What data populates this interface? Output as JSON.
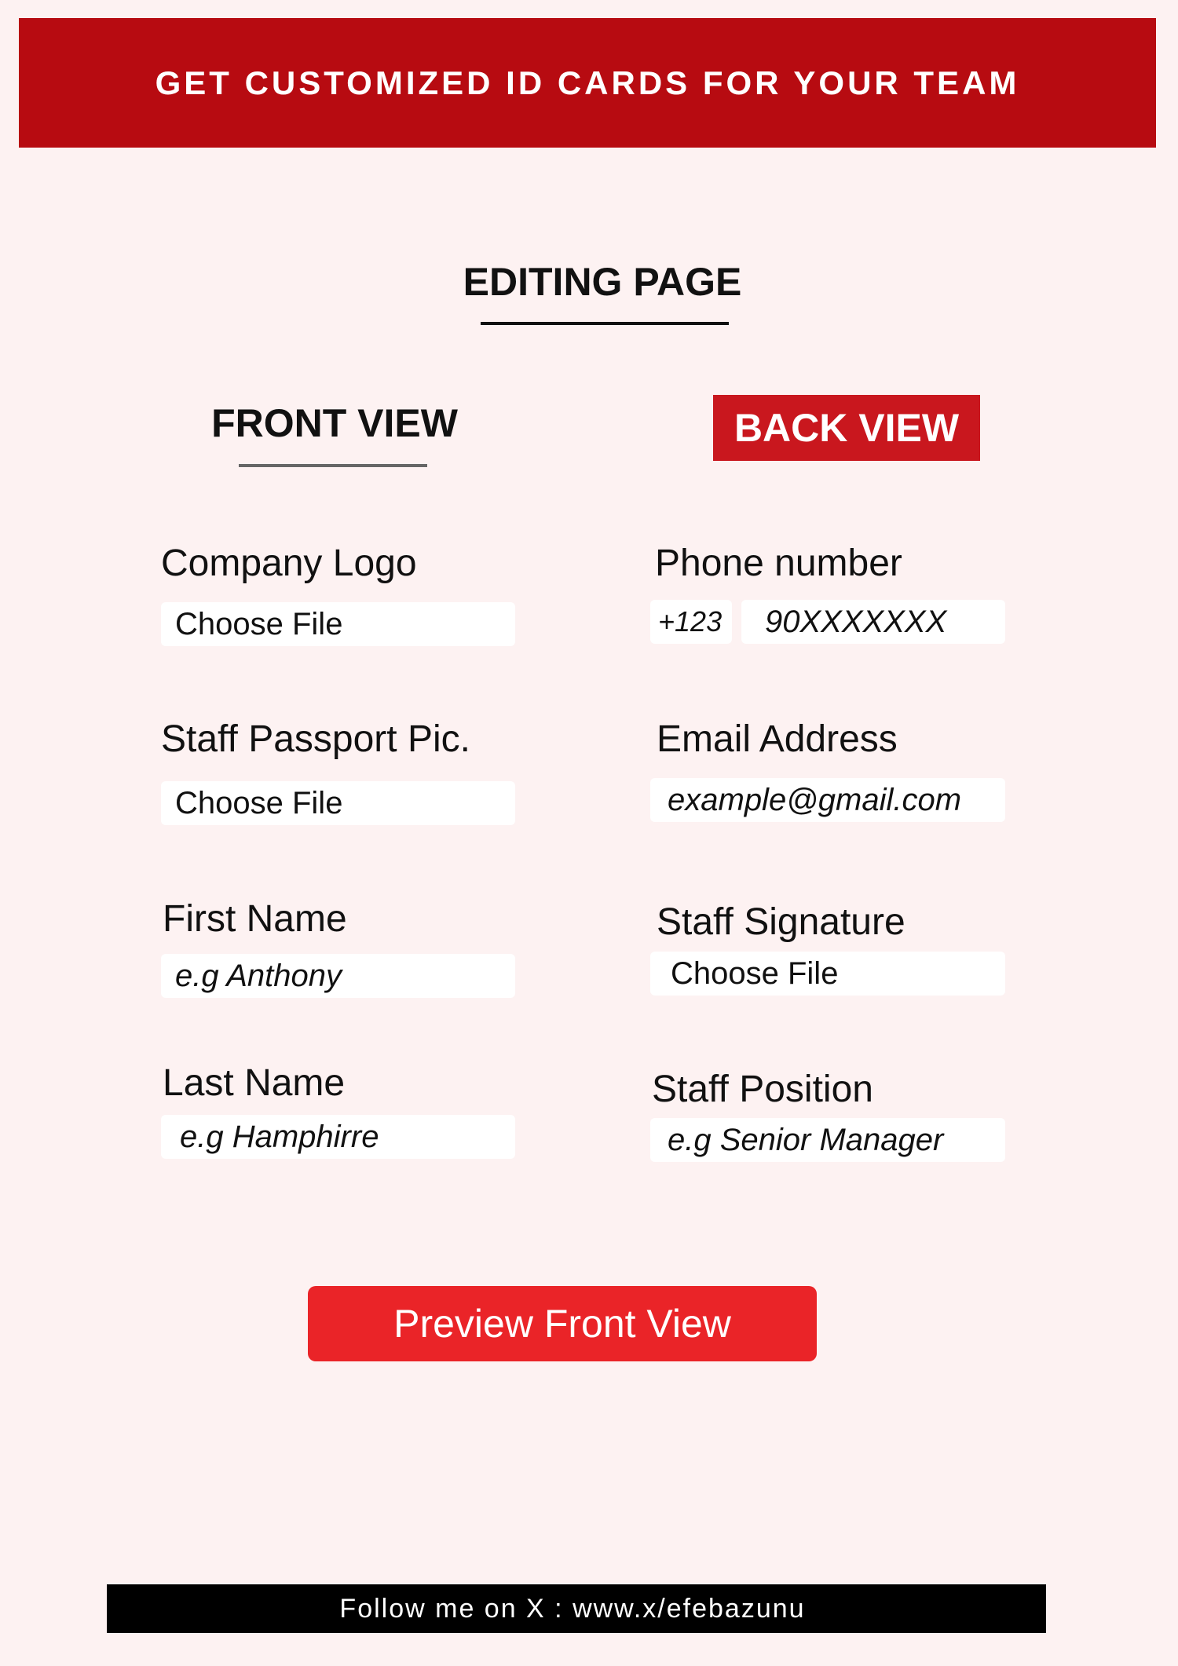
{
  "banner": {
    "title": "GET CUSTOMIZED ID CARDS FOR YOUR TEAM"
  },
  "page": {
    "title": "EDITING PAGE"
  },
  "tabs": {
    "front": "FRONT VIEW",
    "back": "BACK VIEW"
  },
  "front_form": {
    "company_logo": {
      "label": "Company Logo",
      "button": "Choose File"
    },
    "passport_pic": {
      "label": "Staff Passport Pic.",
      "button": "Choose File"
    },
    "first_name": {
      "label": "First Name",
      "placeholder": "e.g Anthony"
    },
    "last_name": {
      "label": "Last Name",
      "placeholder": "e.g Hamphirre"
    }
  },
  "back_form": {
    "phone": {
      "label": "Phone number",
      "country_code": "+123",
      "placeholder": "90XXXXXXX"
    },
    "email": {
      "label": "Email Address",
      "placeholder": "example@gmail.com"
    },
    "signature": {
      "label": "Staff Signature",
      "button": "Choose File"
    },
    "position": {
      "label": "Staff Position",
      "placeholder": "e.g Senior Manager"
    }
  },
  "actions": {
    "preview_label": "Preview Front View"
  },
  "footer": {
    "text": "Follow me on X : www.x/efebazunu"
  },
  "colors": {
    "background": "#fdf2f2",
    "banner": "#b70b11",
    "back_tab": "#c9171e",
    "preview_button": "#ea2428",
    "footer": "#000000"
  }
}
